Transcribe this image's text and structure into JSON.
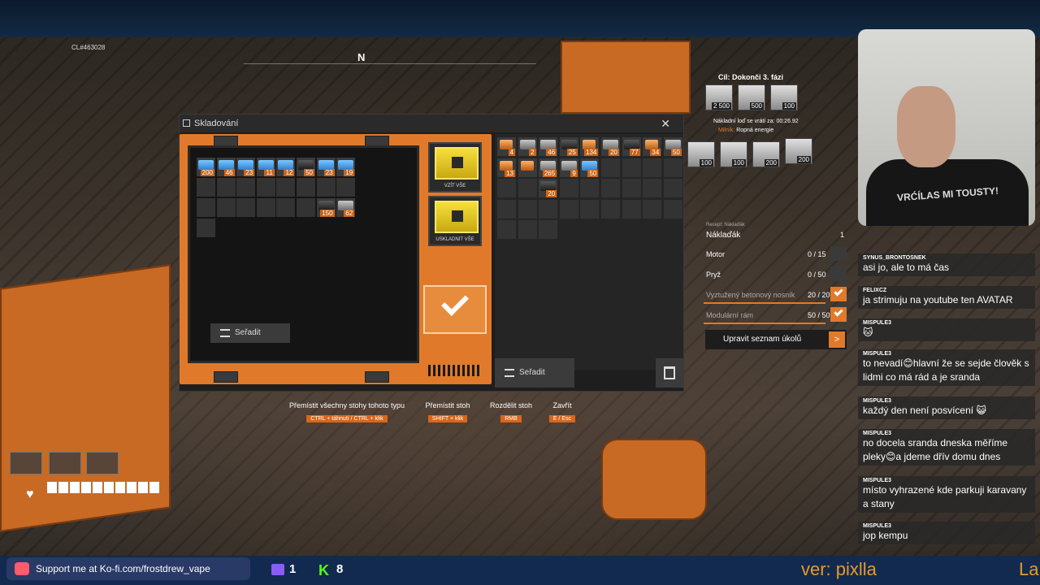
{
  "hud": {
    "compass_label": "N",
    "build_id": "CL#463028"
  },
  "storage_window": {
    "title": "Skladování",
    "close_symbol": "✕",
    "crate_slots": [
      {
        "kind": "blue",
        "count": "200"
      },
      {
        "kind": "blue",
        "count": "46"
      },
      {
        "kind": "blue",
        "count": "23"
      },
      {
        "kind": "blue",
        "count": "11"
      },
      {
        "kind": "blue",
        "count": "12"
      },
      {
        "kind": "dark",
        "count": "50"
      },
      {
        "kind": "blue",
        "count": "23"
      },
      {
        "kind": "blue",
        "count": "19"
      },
      {
        "kind": "dark",
        "count": "150"
      },
      {
        "kind": "gray",
        "count": "62"
      }
    ],
    "sort_label": "Seřadit",
    "take_all_label": "VZÍT VŠE",
    "store_all_label": "USKLADNIT VŠE",
    "inventory_slots": [
      {
        "kind": "orng",
        "count": "4"
      },
      {
        "kind": "gray",
        "count": "2"
      },
      {
        "kind": "gray",
        "count": "46"
      },
      {
        "kind": "dark",
        "count": "25"
      },
      {
        "kind": "orng",
        "count": "134"
      },
      {
        "kind": "gray",
        "count": "20"
      },
      {
        "kind": "dark",
        "count": "77"
      },
      {
        "kind": "orng",
        "count": "34"
      },
      {
        "kind": "gray",
        "count": "50"
      },
      {
        "kind": "orng",
        "count": "13"
      },
      {
        "kind": "orng",
        "count": ""
      },
      {
        "kind": "gray",
        "count": "265"
      },
      {
        "kind": "gray",
        "count": "9"
      },
      {
        "kind": "blue",
        "count": "50"
      },
      {
        "kind": "dark",
        "count": "20"
      }
    ],
    "inventory_sort_label": "Seřadit"
  },
  "hints": [
    {
      "title": "Přemístit všechny stohy tohoto typu",
      "key": "CTRL + táhnutí / CTRL + klik"
    },
    {
      "title": "Přemístit stoh",
      "key": "SHIFT + klik"
    },
    {
      "title": "Rozdělit stoh",
      "key": "RMB"
    },
    {
      "title": "Zavřít",
      "key": "E / Esc"
    }
  ],
  "quest": {
    "goal": "Cíl: Dokonči 3. fázi",
    "top_items": [
      "2 500",
      "500",
      "100"
    ],
    "ship_return": "Nákladní loď se vrátí za: 00:26.92",
    "milestone_label": "Milník:",
    "milestone_value": "Ropná energie",
    "bottom_items": [
      "100",
      "100",
      "200",
      "200"
    ]
  },
  "recipe": {
    "caption": "Recept: Náklaďák",
    "title": "Náklaďák",
    "title_count": "1",
    "rows": [
      {
        "name": "Motor",
        "value": "0 / 15",
        "fill": 0.0,
        "done": false
      },
      {
        "name": "Pryž",
        "value": "0 / 50",
        "fill": 0.0,
        "done": false
      },
      {
        "name": "Vyztužený betonový nosník",
        "value": "20 / 20",
        "fill": 1.0,
        "done": true
      },
      {
        "name": "Modulární rám",
        "value": "50 / 50",
        "fill": 1.0,
        "done": true
      }
    ],
    "tasks_button": "Upravit seznam úkolů",
    "tasks_arrow": ">"
  },
  "webcam": {
    "shirt_text": "VRĆÍLAS MI TOUSTY!"
  },
  "chat": [
    {
      "user": "SYNUS_BRONTOSNEK",
      "text": "asi jo, ale to má čas"
    },
    {
      "user": "FELIXCZ",
      "text": "ja strimuju na youtube ten AVATAR"
    },
    {
      "user": "MISPULE3",
      "text": "🐱"
    },
    {
      "user": "MISPULE3",
      "text": "to nevadí😊hlavní že se sejde člověk s lidmi co má rád a je sranda"
    },
    {
      "user": "MISPULE3",
      "text": "každý den není posvícení 😺"
    },
    {
      "user": "MISPULE3",
      "text": "no docela sranda dneska měříme pleky😊a jdeme dřív domu dnes"
    },
    {
      "user": "MISPULE3",
      "text": "místo vyhrazené kde parkuji karavany a stany"
    },
    {
      "user": "MISPULE3",
      "text": "jop kempu"
    }
  ],
  "bottom_bar": {
    "kofi_text": "Support me at Ko-fi.com/frostdrew_vape",
    "twitch_count": "1",
    "kick_count": "8",
    "ticker_text": "ver: pixlla",
    "ticker_tail": "La"
  }
}
